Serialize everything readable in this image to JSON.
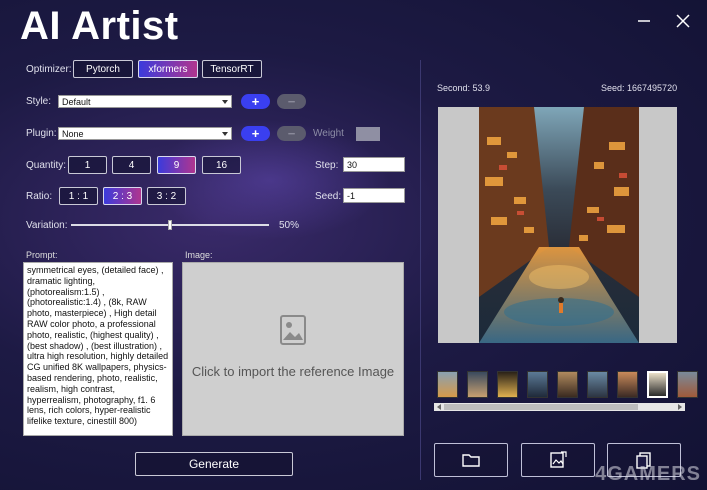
{
  "app": {
    "title": "AI Artist"
  },
  "optimizer": {
    "label": "Optimizer:",
    "options": [
      "Pytorch",
      "xformers",
      "TensorRT"
    ],
    "selected": "xformers"
  },
  "style": {
    "label": "Style:",
    "value": "Default"
  },
  "plugin": {
    "label": "Plugin:",
    "value": "None",
    "weight_label": "Weight"
  },
  "quantity": {
    "label": "Quantity:",
    "options": [
      "1",
      "4",
      "9",
      "16"
    ],
    "selected": "9"
  },
  "ratio": {
    "label": "Ratio:",
    "options": [
      "1 : 1",
      "2 : 3",
      "3 : 2"
    ],
    "selected": "2 : 3"
  },
  "step": {
    "label": "Step:",
    "value": "30"
  },
  "seed": {
    "label": "Seed:",
    "value": "-1"
  },
  "variation": {
    "label": "Variation:",
    "value_text": "50%",
    "level": 0.5
  },
  "prompt": {
    "label": "Prompt:",
    "text": "symmetrical eyes, (detailed face) , dramatic lighting, (photorealism:1.5) , (photorealistic:1.4) , (8k, RAW photo, masterpiece) , High detail RAW color photo, a professional photo, realistic, (highest quality) , (best shadow) , (best illustration) , ultra high resolution, highly detailed CG unified 8K wallpapers, physics-based rendering, photo, realistic, realism, high contrast, hyperrealism, photography, f1. 6 lens, rich colors, hyper-realistic lifelike texture, cinestill 800)"
  },
  "image": {
    "label": "Image:",
    "placeholder": "Click to import the reference Image"
  },
  "generate": {
    "label": "Generate"
  },
  "result": {
    "second_text": "Second: 53.9",
    "seed_text": "Seed: 1667495720"
  },
  "thumbnails": {
    "count": 9,
    "selected_index": 7
  },
  "scroll": {
    "position": 0.05
  },
  "actions": [
    "open-folder-icon",
    "export-image-icon",
    "copy-icon"
  ],
  "watermark": "4GAMERS",
  "colors": {
    "accent_blue": "#3a3ff0",
    "accent_gradient_end": "#b0358e",
    "background": "#1d1a44"
  }
}
